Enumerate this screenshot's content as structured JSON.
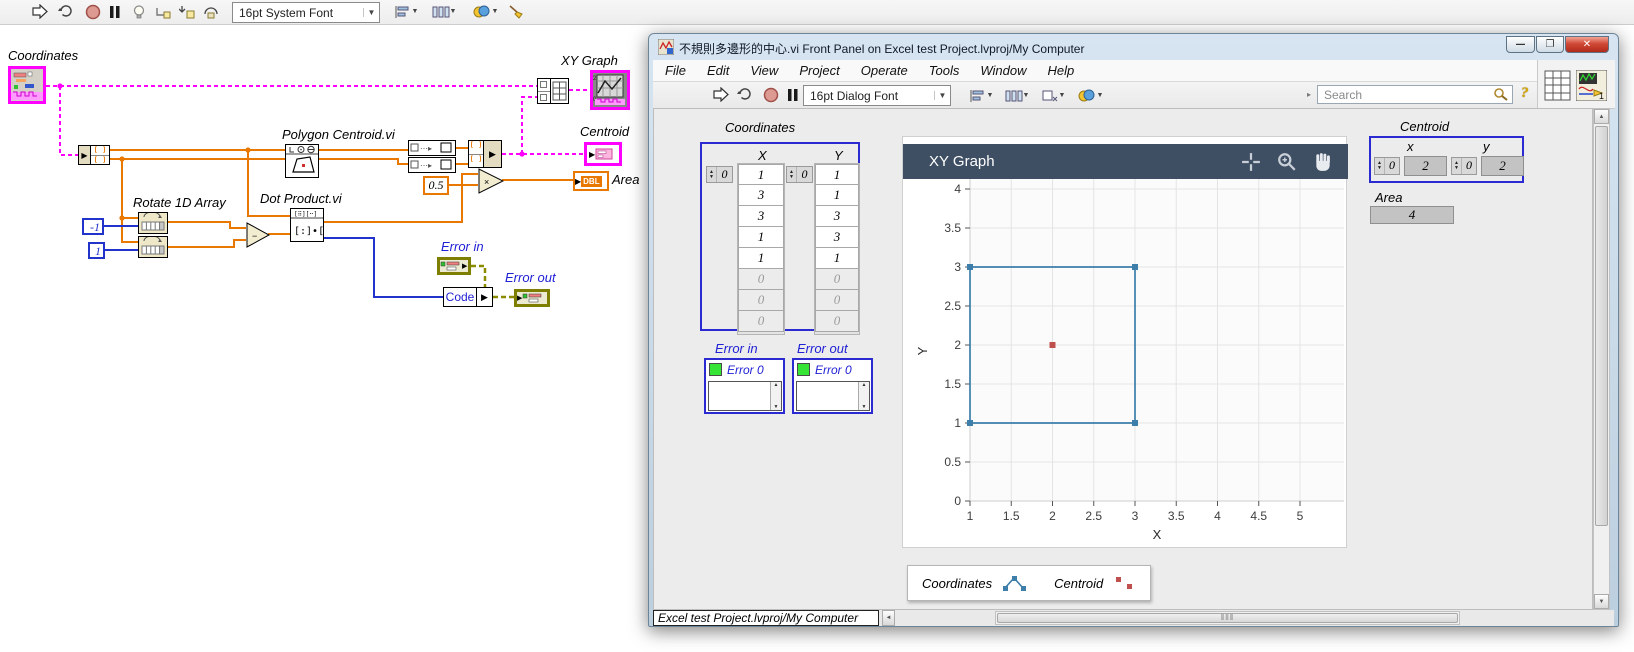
{
  "bd": {
    "toolbar": {
      "font_selector": "16pt System Font"
    },
    "labels": {
      "coordinates": "Coordinates",
      "xy_graph": "XY Graph",
      "centroid": "Centroid",
      "area": "Area",
      "polygon_vi": "Polygon Centroid.vi",
      "dot_vi": "Dot Product.vi",
      "rotate": "Rotate 1D Array",
      "error_in": "Error in",
      "error_out": "Error out",
      "code": "Code",
      "const_neg1": "-1",
      "const_one": "1",
      "const_half": "0.5",
      "dbl": "DBL"
    }
  },
  "fp": {
    "title": "不規則多邊形的中心.vi Front Panel on Excel test  Project.lvproj/My Computer",
    "menus": [
      "File",
      "Edit",
      "View",
      "Project",
      "Operate",
      "Tools",
      "Window",
      "Help"
    ],
    "toolbar": {
      "font_selector": "16pt Dialog Font",
      "search_placeholder": "Search",
      "help_label": "?"
    },
    "coordinates": {
      "label": "Coordinates",
      "x_header": "X",
      "y_header": "Y",
      "x_index": "0",
      "y_index": "0",
      "x_values": [
        "1",
        "3",
        "3",
        "1",
        "1",
        "0",
        "0",
        "0"
      ],
      "y_values": [
        "1",
        "1",
        "3",
        "3",
        "1",
        "0",
        "0",
        "0"
      ]
    },
    "error_in": {
      "label": "Error in",
      "status": "Error 0"
    },
    "error_out": {
      "label": "Error out",
      "status": "Error 0"
    },
    "centroid": {
      "label": "Centroid",
      "x_header": "x",
      "y_header": "y",
      "x_index": "0",
      "y_index": "0",
      "x_value": "2",
      "y_value": "2"
    },
    "area": {
      "label": "Area",
      "value": "4"
    },
    "legend": {
      "coordinates": "Coordinates",
      "centroid": "Centroid"
    },
    "status_bar": "Excel test  Project.lvproj/My Computer"
  },
  "chart_data": {
    "type": "line",
    "title": "XY Graph",
    "xlabel": "X",
    "ylabel": "Y",
    "xlim": [
      1,
      5
    ],
    "ylim": [
      0,
      4
    ],
    "xticks": [
      1,
      1.5,
      2,
      2.5,
      3,
      3.5,
      4,
      4.5,
      5
    ],
    "yticks": [
      0,
      0.5,
      1,
      1.5,
      2,
      2.5,
      3,
      3.5,
      4
    ],
    "grid": true,
    "legend_position": "bottom",
    "series": [
      {
        "name": "Coordinates",
        "color": "#3d7eaa",
        "marker": "square",
        "line": "solid",
        "x": [
          1,
          3,
          3,
          1,
          1
        ],
        "y": [
          1,
          1,
          3,
          3,
          1
        ]
      },
      {
        "name": "Centroid",
        "color": "#c0504d",
        "marker": "square",
        "line": "none",
        "x": [
          2
        ],
        "y": [
          2
        ]
      }
    ]
  },
  "colors": {
    "accent_magenta": "#ff00ff",
    "wire_orange": "#e87800",
    "wire_blue": "#2233cc",
    "error_olive": "#8b8b00",
    "graph_header": "#3e4e63",
    "led_green": "#35e435"
  }
}
